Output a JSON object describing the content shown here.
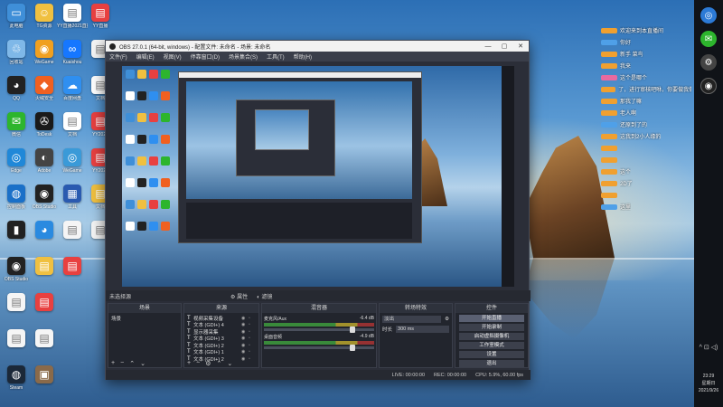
{
  "desktop": {
    "icons": [
      {
        "label": "此电脑",
        "color": "#3f8fd8",
        "glyph": "▭",
        "col": 0,
        "row": 0
      },
      {
        "label": "TG资源",
        "color": "#f0c040",
        "glyph": "☺",
        "col": 1,
        "row": 0
      },
      {
        "label": "YY直播2021直播",
        "color": "#ffffff",
        "glyph": "▤",
        "col": 2,
        "row": 0
      },
      {
        "label": "YY直播",
        "color": "#e84040",
        "glyph": "▤",
        "col": 3,
        "row": 0
      },
      {
        "label": "回收站",
        "color": "#7fb8e8",
        "glyph": "♲",
        "col": 0,
        "row": 1
      },
      {
        "label": "WeGame",
        "color": "#f0a020",
        "glyph": "◉",
        "col": 1,
        "row": 1
      },
      {
        "label": "Kuaishou",
        "color": "#1677ff",
        "glyph": "∞",
        "col": 2,
        "row": 1
      },
      {
        "label": "",
        "color": "#f5f5f5",
        "glyph": "▤",
        "col": 3,
        "row": 1
      },
      {
        "label": "QQ",
        "color": "#222222",
        "glyph": "◕",
        "col": 0,
        "row": 2
      },
      {
        "label": "火绒安全",
        "color": "#f06020",
        "glyph": "◆",
        "col": 1,
        "row": 2
      },
      {
        "label": "百度网盘",
        "color": "#2f8ff0",
        "glyph": "☁",
        "col": 2,
        "row": 2
      },
      {
        "label": "文档",
        "color": "#ffffff",
        "glyph": "▤",
        "col": 3,
        "row": 2
      },
      {
        "label": "微信",
        "color": "#2db52d",
        "glyph": "✉",
        "col": 0,
        "row": 3
      },
      {
        "label": "ToDesk",
        "color": "#1a1a1a",
        "glyph": "✇",
        "col": 1,
        "row": 3
      },
      {
        "label": "文档",
        "color": "#ffffff",
        "glyph": "▤",
        "col": 2,
        "row": 3
      },
      {
        "label": "YY2021",
        "color": "#e84040",
        "glyph": "▤",
        "col": 3,
        "row": 3
      },
      {
        "label": "Edge",
        "color": "#2088d8",
        "glyph": "◎",
        "col": 0,
        "row": 4
      },
      {
        "label": "Adobe",
        "color": "#444444",
        "glyph": "◐",
        "col": 1,
        "row": 4
      },
      {
        "label": "WeGame",
        "color": "#3a9ad8",
        "glyph": "◎",
        "col": 2,
        "row": 4
      },
      {
        "label": "YY2021",
        "color": "#e84040",
        "glyph": "▤",
        "col": 3,
        "row": 4
      },
      {
        "label": "控制面板",
        "color": "#1a70c8",
        "glyph": "◍",
        "col": 0,
        "row": 5
      },
      {
        "label": "OBS Studio",
        "color": "#222222",
        "glyph": "◉",
        "col": 1,
        "row": 5
      },
      {
        "label": "工具",
        "color": "#2a5ab0",
        "glyph": "▦",
        "col": 2,
        "row": 5
      },
      {
        "label": "文档",
        "color": "#f0c040",
        "glyph": "▤",
        "col": 3,
        "row": 5
      },
      {
        "label": "",
        "color": "#222222",
        "glyph": "▮",
        "col": 0,
        "row": 6
      },
      {
        "label": "",
        "color": "#2a8ae0",
        "glyph": "◕",
        "col": 1,
        "row": 6
      },
      {
        "label": "",
        "color": "#f5f5f5",
        "glyph": "▤",
        "col": 2,
        "row": 6
      },
      {
        "label": "",
        "color": "#f5f5f5",
        "glyph": "▤",
        "col": 3,
        "row": 6
      },
      {
        "label": "OBS Studio",
        "color": "#222222",
        "glyph": "◉",
        "col": 0,
        "row": 7
      },
      {
        "label": "",
        "color": "#f0c040",
        "glyph": "▤",
        "col": 1,
        "row": 7
      },
      {
        "label": "",
        "color": "#e84040",
        "glyph": "▤",
        "col": 2,
        "row": 7
      },
      {
        "label": "",
        "color": "#f5f5f5",
        "glyph": "▤",
        "col": 0,
        "row": 8
      },
      {
        "label": "",
        "color": "#e84040",
        "glyph": "▤",
        "col": 1,
        "row": 8
      },
      {
        "label": "",
        "color": "#f5f5f5",
        "glyph": "▤",
        "col": 0,
        "row": 9
      },
      {
        "label": "",
        "color": "#f5f5f5",
        "glyph": "▤",
        "col": 1,
        "row": 9
      },
      {
        "label": "Steam",
        "color": "#1b2838",
        "glyph": "◍",
        "col": 0,
        "row": 10
      },
      {
        "label": "",
        "color": "#8a6a4a",
        "glyph": "▣",
        "col": 1,
        "row": 10
      }
    ]
  },
  "chat": [
    {
      "badge": "orange",
      "text": "欢迎来到本直播间"
    },
    {
      "badge": "blue",
      "text": "你好"
    },
    {
      "badge": "orange",
      "text": "新手 菜鸟"
    },
    {
      "badge": "orange",
      "text": "我来"
    },
    {
      "badge": "pink",
      "text": "这个是哪个"
    },
    {
      "badge": "orange",
      "text": "了，进行审核吧咻，你要做我做人"
    },
    {
      "badge": "orange",
      "text": "那我了嘛"
    },
    {
      "badge": "orange",
      "text": "老人啊"
    },
    {
      "badge": "blue",
      "text": "还原到了的"
    },
    {
      "badge": "orange",
      "text": "这我到2小人缘的"
    },
    {
      "badge": "orange",
      "text": ""
    },
    {
      "badge": "orange",
      "text": ""
    },
    {
      "badge": "orange",
      "text": "这个"
    },
    {
      "badge": "orange",
      "text": "2D了"
    },
    {
      "badge": "orange",
      "text": ""
    },
    {
      "badge": "blue",
      "text": "这里"
    }
  ],
  "obs": {
    "title": "OBS 27.0.1 (64-bit, windows) - 配置文件: 未命名 - 场景: 未命名",
    "window_buttons": [
      "—",
      "▢",
      "✕"
    ],
    "menu": [
      "文件(F)",
      "编辑(E)",
      "视图(V)",
      "停靠窗口(D)",
      "场景集合(S)",
      "工具(T)",
      "帮助(H)"
    ],
    "bar": {
      "label": "未选择源",
      "props": "属性",
      "filters": "滤镜"
    },
    "scenes": {
      "head": "场景",
      "items": [
        "场景"
      ]
    },
    "sources": {
      "head": "来源",
      "items": [
        "视频采集设备",
        "文本 (GDI+) 4",
        "显示器采集",
        "文本 (GDI+) 3",
        "文本 (GDI+) 2",
        "文本 (GDI+) 1",
        "文本 (GDI+) 2"
      ]
    },
    "mixer": {
      "head": "混音器",
      "channels": [
        {
          "name": "麦克风/Aux",
          "db": "-6.4 dB"
        },
        {
          "name": "桌面音频",
          "db": "-4.9 dB"
        }
      ]
    },
    "transitions": {
      "head": "转场特效",
      "type": "淡出",
      "duration_label": "时长",
      "duration": "300 ms"
    },
    "controls": {
      "head": "控件",
      "buttons": [
        "开始直播",
        "开始录制",
        "启动虚拟摄像机",
        "工作室模式",
        "设置",
        "退出"
      ]
    },
    "status": {
      "live": "LIVE: 00:00:00",
      "rec": "REC: 00:00:00",
      "cpu": "CPU: 5.9%, 60.00 fps"
    }
  },
  "taskbar": {
    "icons": [
      "edge-icon",
      "wechat-icon",
      "settings-icon",
      "obs-icon"
    ],
    "tray": "^ ⊡ ◁)",
    "time": "23:29",
    "weekday": "星期日",
    "date": "2021/9/26"
  }
}
